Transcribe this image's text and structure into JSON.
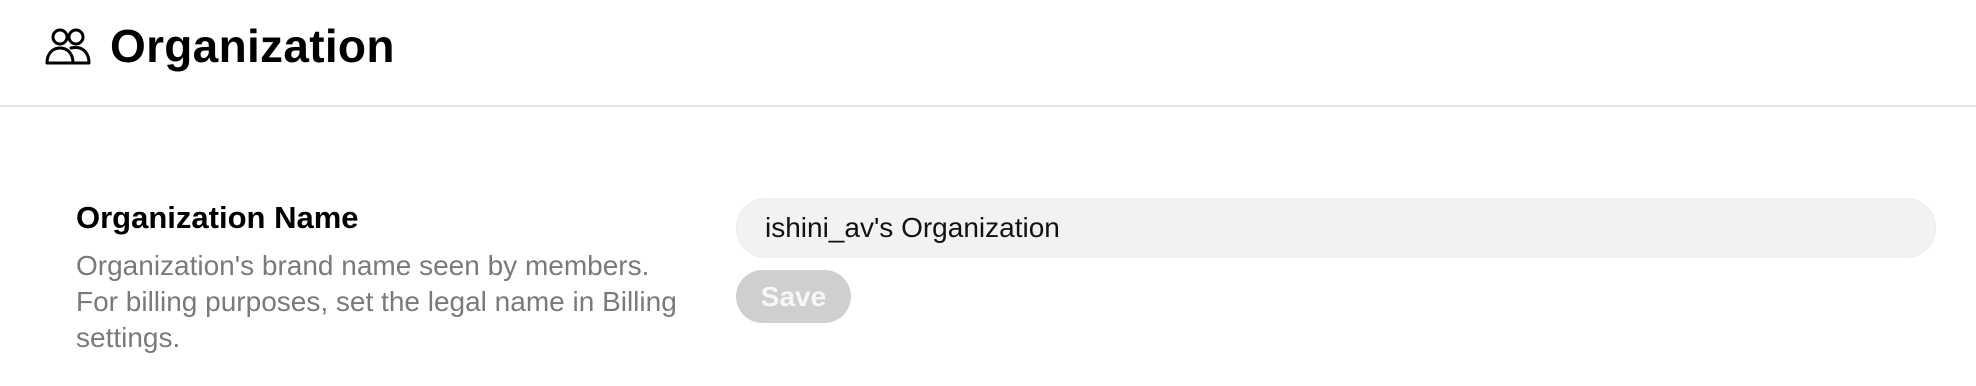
{
  "header": {
    "icon": "users-icon",
    "title": "Organization"
  },
  "organization_name": {
    "label": "Organization Name",
    "description": "Organization's brand name seen by members. For billing purposes, set the legal name in Billing settings.",
    "input_value": "ishini_av's Organization",
    "save_label": "Save",
    "save_enabled": false
  },
  "colors": {
    "divider": "#e3e3e3",
    "input_background": "#f2f2f2",
    "save_disabled_background": "#cfcfcf",
    "description_text": "#7a7a7a"
  }
}
